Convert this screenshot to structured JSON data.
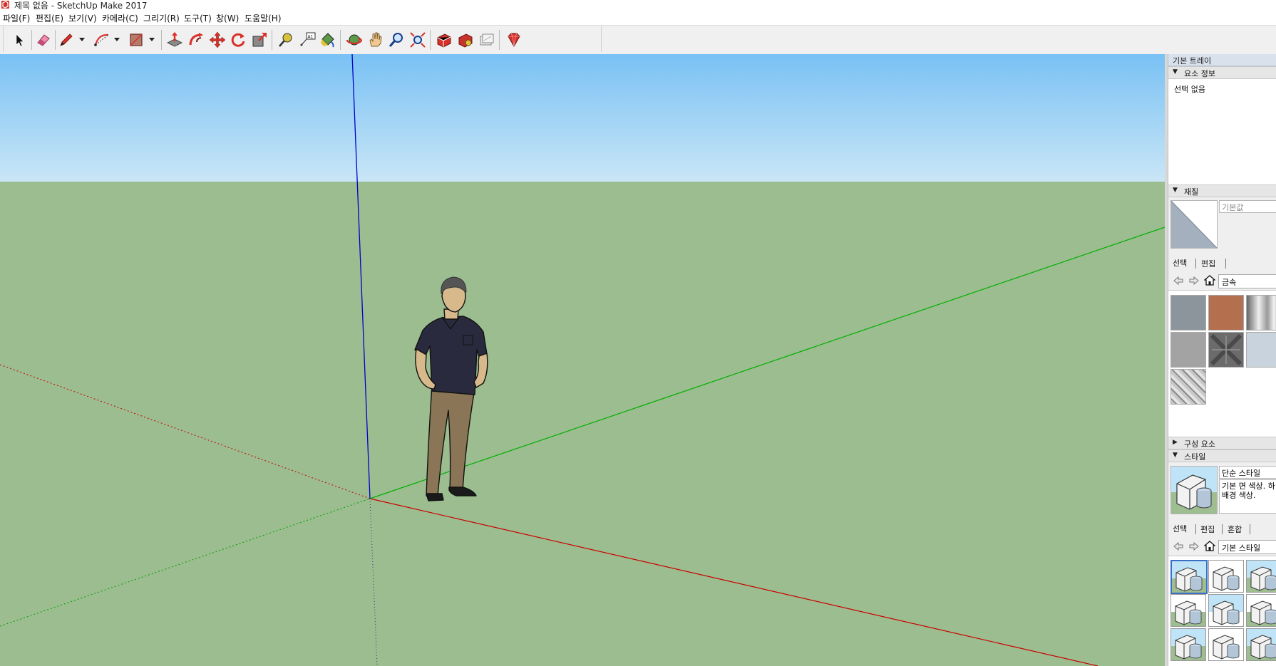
{
  "window": {
    "title": "제목 없음 - SketchUp Make 2017"
  },
  "menu": {
    "items": [
      "파일(F)",
      "편집(E)",
      "보기(V)",
      "카메라(C)",
      "그리기(R)",
      "도구(T)",
      "창(W)",
      "도움말(H)"
    ]
  },
  "toolbar": {
    "tools": [
      "select-icon",
      "eraser-icon",
      "pencil-line-icon",
      "arc-icon",
      "rectangle-icon",
      "push-pull-icon",
      "follow-me-icon",
      "move-icon",
      "rotate-icon",
      "scale-icon",
      "tape-measure-icon",
      "text-label-icon",
      "paint-bucket-icon",
      "orbit-icon",
      "pan-icon",
      "zoom-icon",
      "zoom-extents-icon",
      "3d-warehouse-icon",
      "extension-warehouse-icon",
      "layout-icon",
      "ruby-extension-icon"
    ]
  },
  "scene": {
    "sky_color": "#87c7f4",
    "ground_color": "#9bbd8f",
    "x_axis_color": "#cc0000",
    "y_axis_color": "#00a000",
    "z_axis_color": "#0000cc"
  },
  "tray": {
    "title": "기본 트레이",
    "entity_info": {
      "header": "요소 정보",
      "text": "선택 없음"
    },
    "materials": {
      "header": "재질",
      "name_placeholder": "기본값",
      "tabs": [
        "선택",
        "편집"
      ],
      "collection": "금속",
      "swatches": [
        "metal-gray-swatch",
        "metal-copper-swatch",
        "metal-brushed-swatch",
        "metal-light-gray-swatch",
        "metal-pattern-swatch",
        "metal-blue-gray-swatch",
        "metal-diamond-plate-swatch"
      ]
    },
    "components": {
      "header": "구성 요소"
    },
    "styles": {
      "header": "스타일",
      "style_name": "단순 스타일",
      "style_description": "기본 면 색상. 하\n배경 색상.",
      "tabs": [
        "선택",
        "편집",
        "혼합"
      ],
      "collection": "기본 스타일"
    }
  }
}
